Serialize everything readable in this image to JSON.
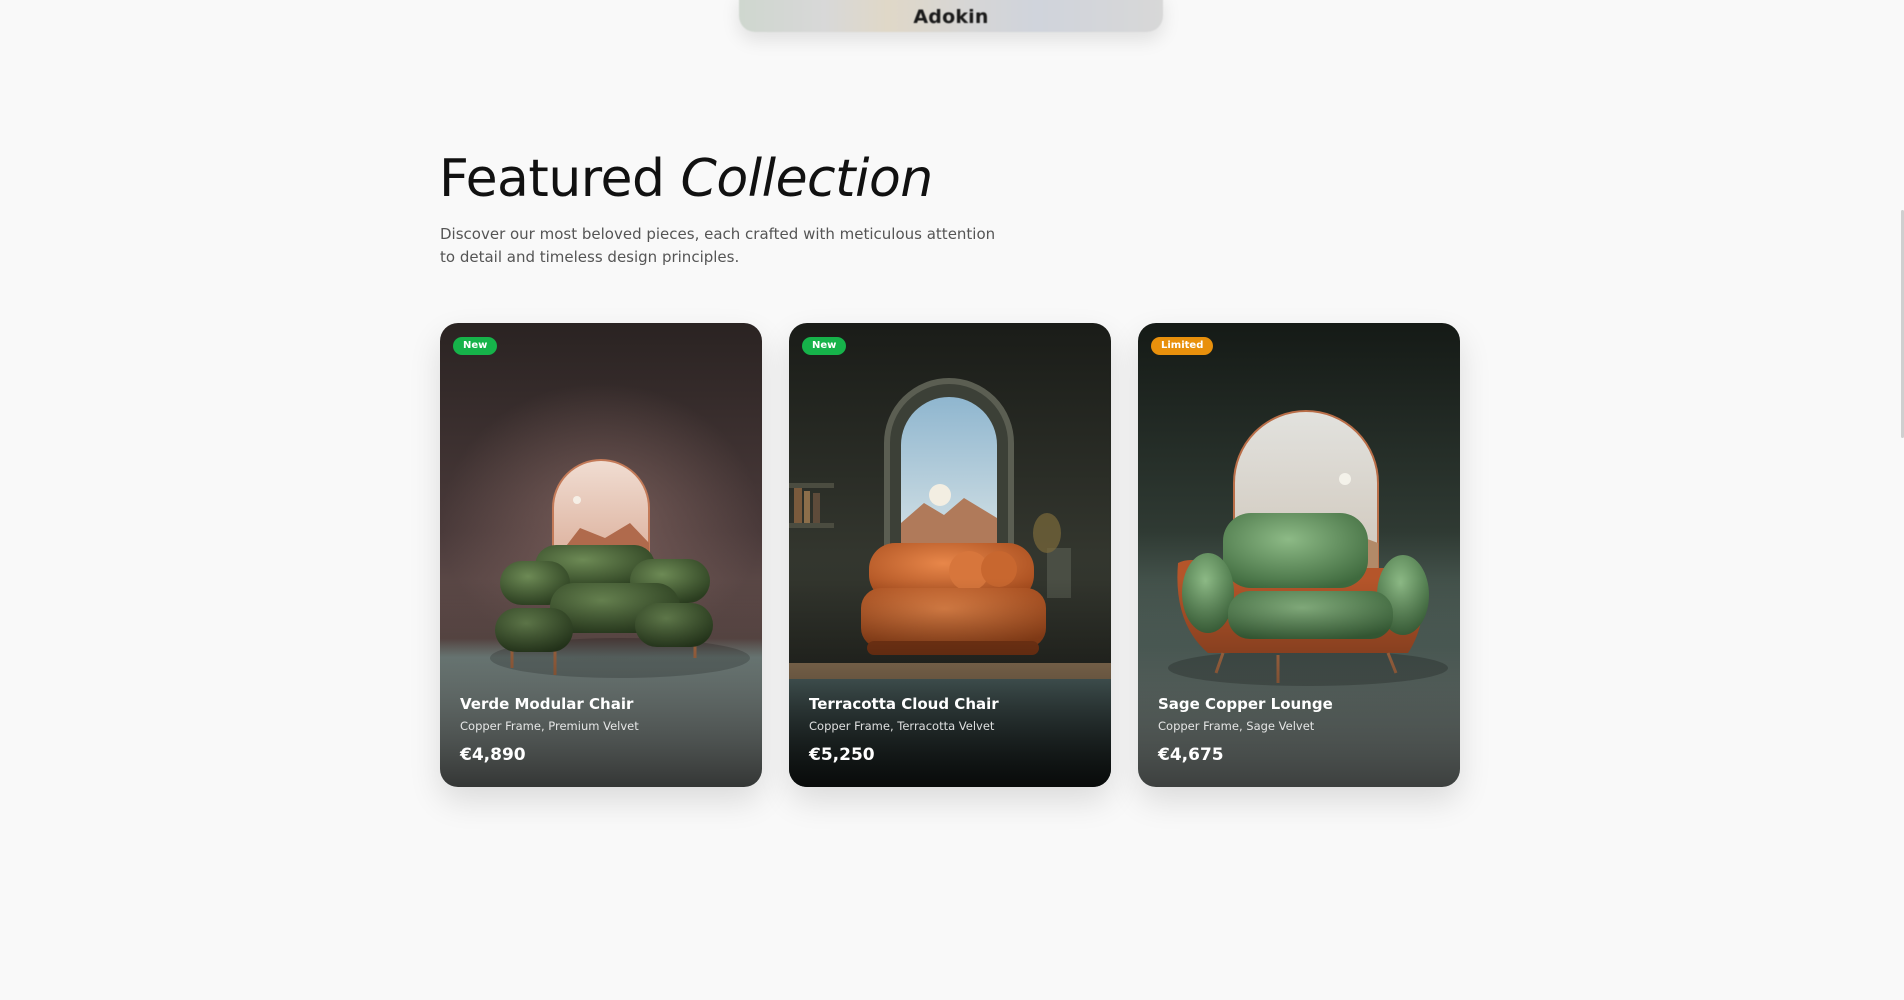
{
  "header": {
    "brand": "Adokin"
  },
  "section": {
    "title_main": "Featured",
    "title_accent": "Collection",
    "subtitle": "Discover our most beloved pieces, each crafted with meticulous attention to detail and timeless design principles."
  },
  "products": [
    {
      "badge": "New",
      "badge_color": "#16b34a",
      "name": "Verde Modular Chair",
      "materials": "Copper Frame, Premium Velvet",
      "price": "€4,890"
    },
    {
      "badge": "New",
      "badge_color": "#16b34a",
      "name": "Terracotta Cloud Chair",
      "materials": "Copper Frame, Terracotta Velvet",
      "price": "€5,250"
    },
    {
      "badge": "Limited",
      "badge_color": "#e8900c",
      "name": "Sage Copper Lounge",
      "materials": "Copper Frame, Sage Velvet",
      "price": "€4,675"
    }
  ]
}
